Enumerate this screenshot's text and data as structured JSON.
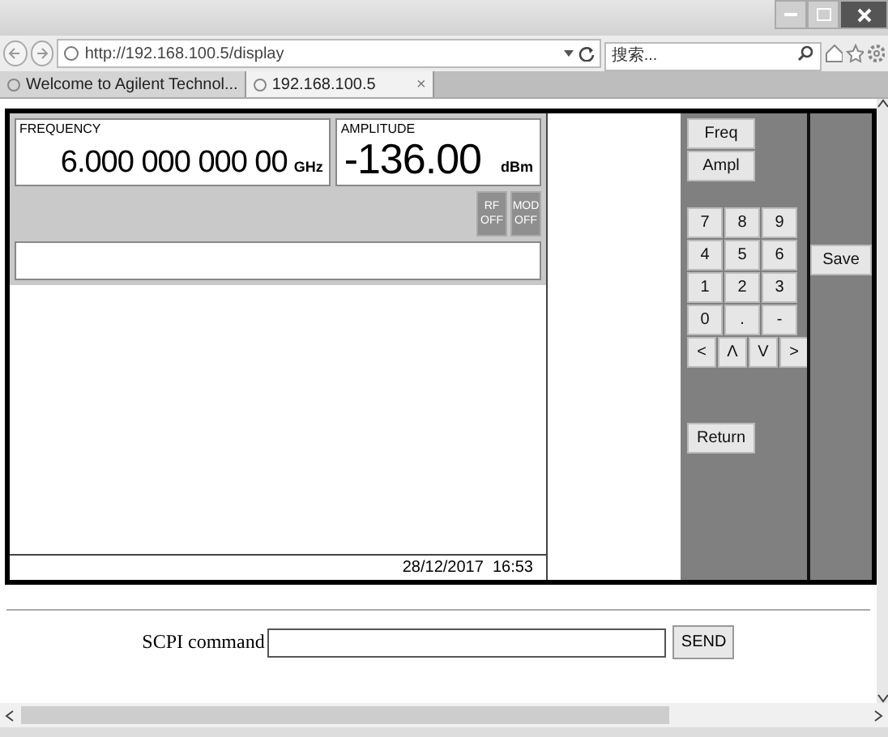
{
  "browser": {
    "address": "http://192.168.100.5/display",
    "search": {
      "placeholder": "搜索..."
    },
    "tabs": [
      {
        "label": "Welcome to Agilent Technol...",
        "selected": false
      },
      {
        "label": "192.168.100.5",
        "selected": true,
        "close": "×"
      }
    ]
  },
  "instrument": {
    "frequency": {
      "label": "FREQUENCY",
      "value": "6.000 000 000 00",
      "unit": "GHz"
    },
    "amplitude": {
      "label": "AMPLITUDE",
      "value": "-136.00",
      "unit": "dBm"
    },
    "indicators": [
      "RF OFF",
      "MOD OFF"
    ],
    "timestamp": "28/12/2017  16:53",
    "menu_keys": [
      "Freq",
      "Ampl"
    ],
    "keypad": [
      [
        "7",
        "8",
        "9"
      ],
      [
        "4",
        "5",
        "6"
      ],
      [
        "1",
        "2",
        "3"
      ],
      [
        "0",
        ".",
        "-"
      ]
    ],
    "arrow_keys": [
      "<",
      "Λ",
      "V",
      ">"
    ],
    "return_key": "Return",
    "side_keys": [
      "Save"
    ]
  },
  "scpi": {
    "label": "SCPI command",
    "button": "SEND"
  }
}
